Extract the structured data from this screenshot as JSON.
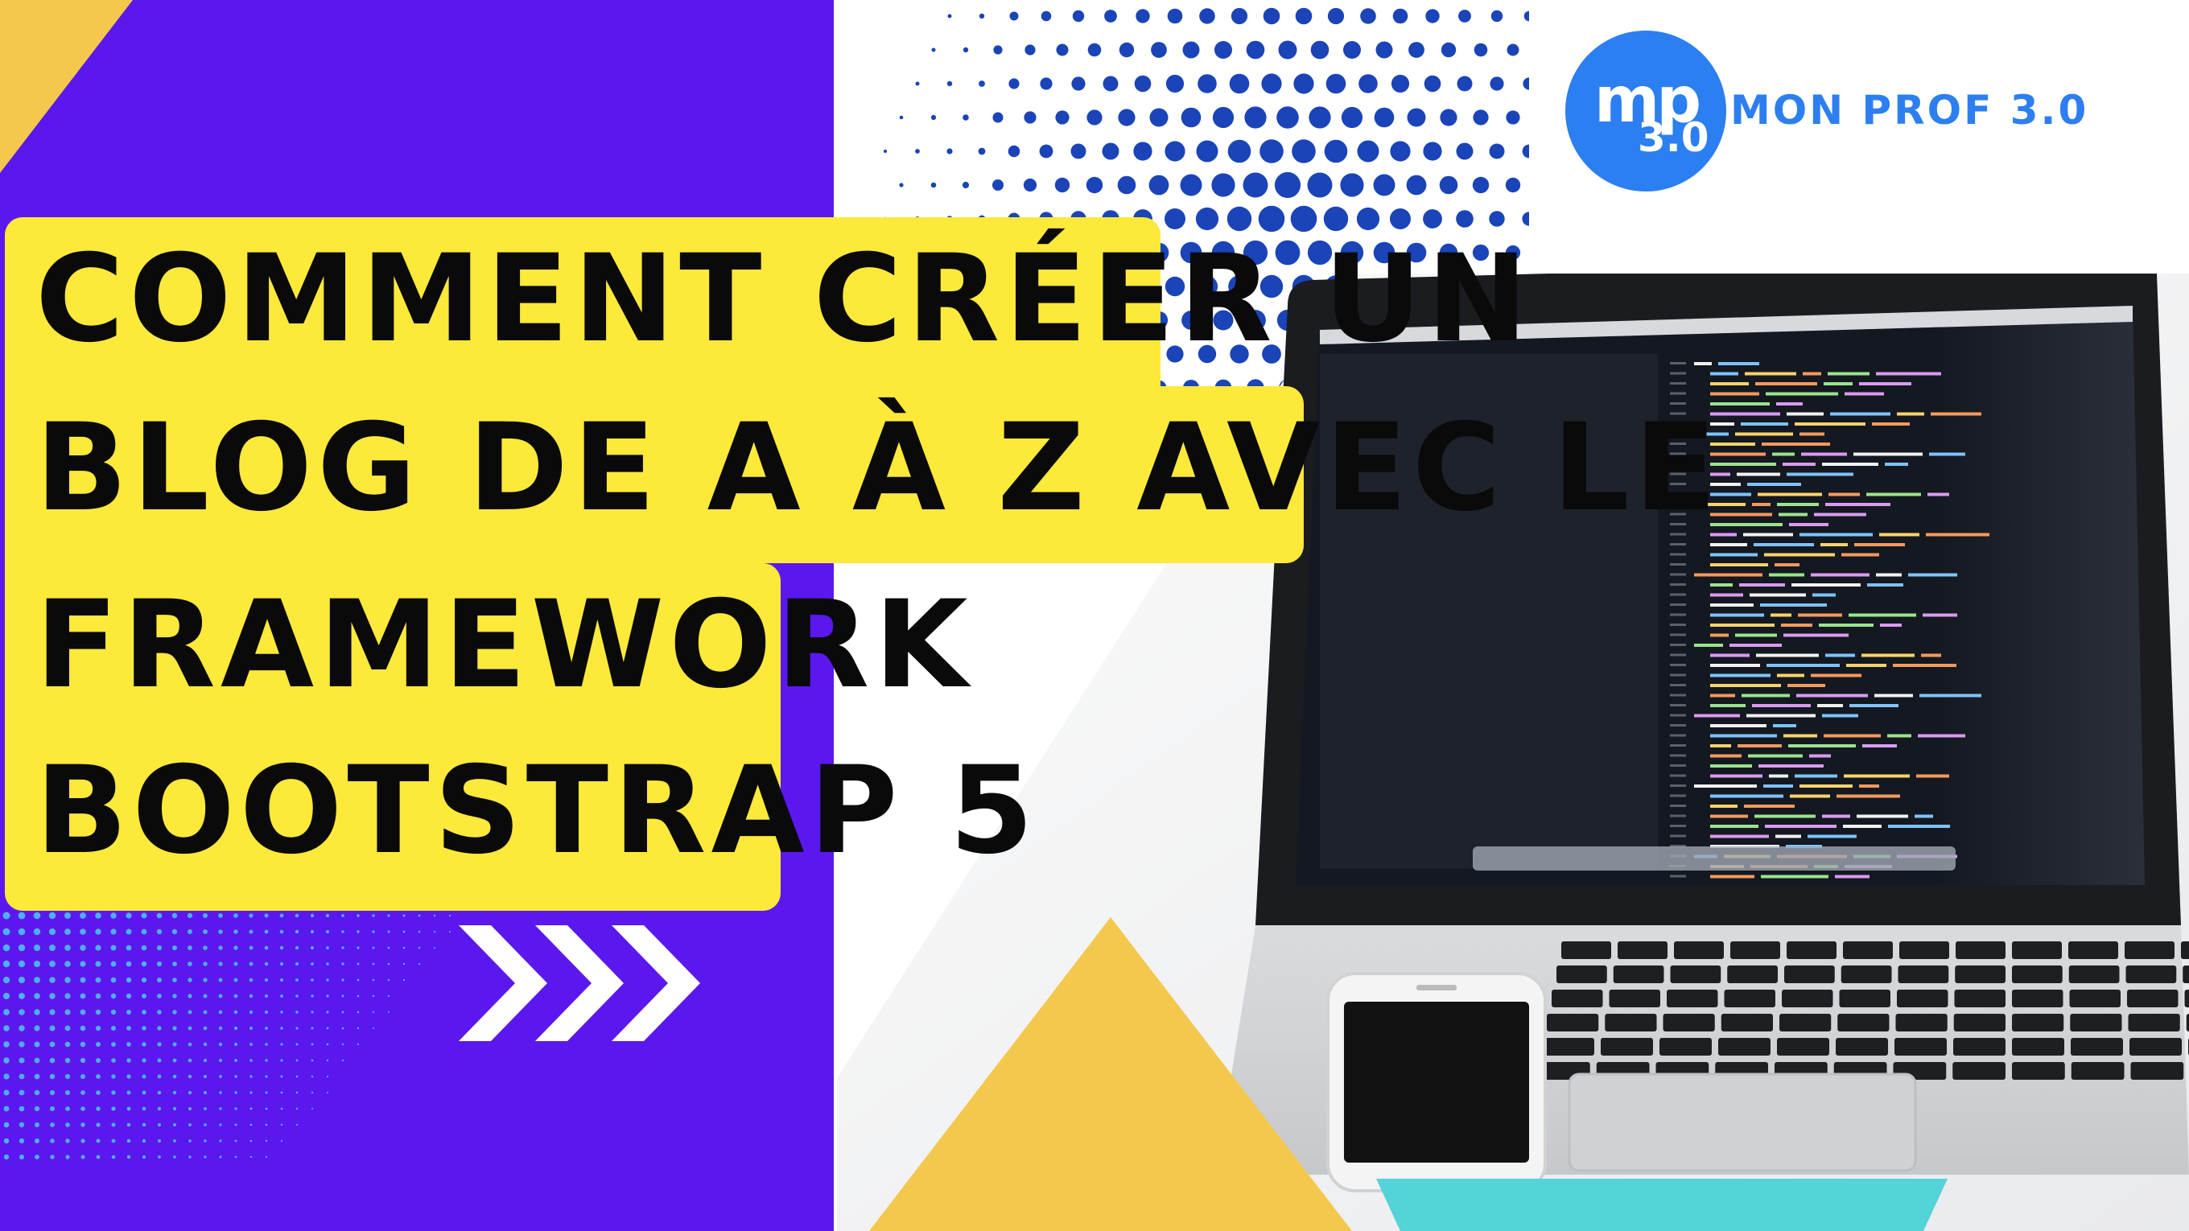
{
  "title": {
    "lines": [
      "Comment créer un",
      "blog de A à Z avec le",
      "framework",
      "Bootstrap 5"
    ]
  },
  "logo": {
    "mark": "mp",
    "version": "3.0",
    "name": "MON PROF 3.0"
  },
  "colors": {
    "purple": "#5a18ee",
    "yellow": "#fde93a",
    "gold": "#f4c84c",
    "blue_dots": "#1a44b8",
    "logo_blue": "#2b7ff0",
    "teal": "#54d3d8",
    "dots_cyan": "#4fb0ff"
  },
  "icons": [
    "chevron-right-icon",
    "laptop-icon",
    "smartphone-icon",
    "dot-sphere-icon"
  ]
}
